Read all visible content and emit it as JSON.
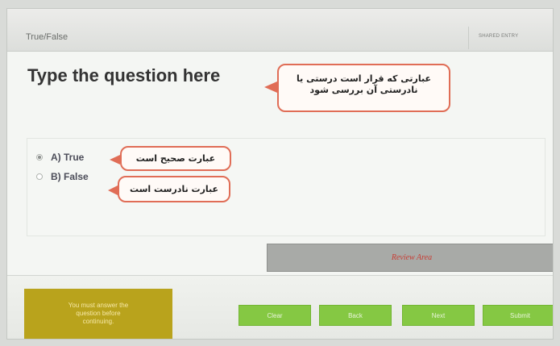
{
  "header": {
    "title": "True/False",
    "slide_info": "SHARED ENTRY"
  },
  "question": {
    "text": "Type the question here"
  },
  "callouts": {
    "question_note": "عبارتی که قرار است درستی یا\nنادرستی آن بررسی شود",
    "true_note": "عبارت صحیح است",
    "false_note": "عبارت نادرست است"
  },
  "answers": [
    {
      "label": "A) True",
      "selected": true
    },
    {
      "label": "B) False",
      "selected": false
    }
  ],
  "review_bar": {
    "label": "Review Area"
  },
  "footer": {
    "message": "You must answer the\nquestion before\ncontinuing.",
    "buttons": [
      "Clear",
      "Back",
      "Next",
      "Submit"
    ]
  },
  "colors": {
    "accent_green": "#85c843",
    "message_background": "#b9a31c",
    "callout_border": "#e06d56",
    "review_bar_background": "#a8aaa7"
  }
}
